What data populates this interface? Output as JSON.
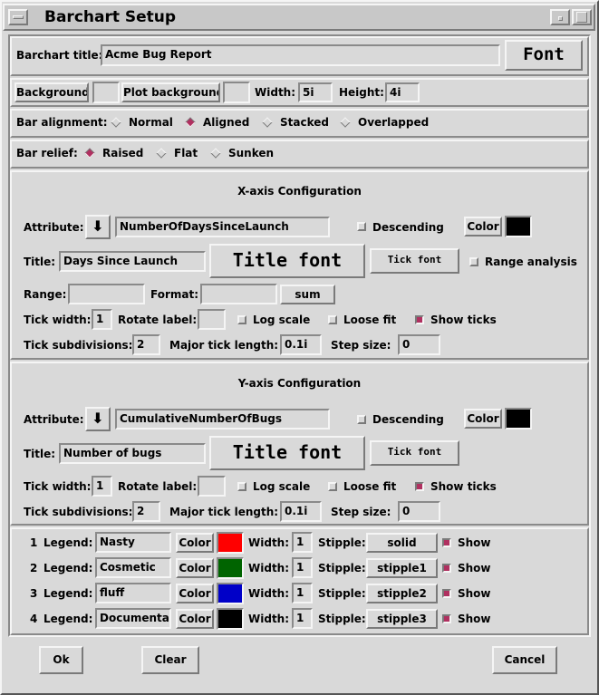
{
  "window": {
    "title": "Barchart Setup"
  },
  "general": {
    "chart_title_label": "Barchart title:",
    "chart_title_value": "Acme Bug Report",
    "font_button": "Font",
    "background_button": "Background",
    "plot_background_button": "Plot background",
    "width_label": "Width:",
    "width_value": "5i",
    "height_label": "Height:",
    "height_value": "4i"
  },
  "bar_alignment": {
    "label": "Bar alignment:",
    "options": [
      "Normal",
      "Aligned",
      "Stacked",
      "Overlapped"
    ],
    "selected": "Aligned"
  },
  "bar_relief": {
    "label": "Bar relief:",
    "options": [
      "Raised",
      "Flat",
      "Sunken"
    ],
    "selected": "Raised"
  },
  "xaxis": {
    "heading": "X-axis Configuration",
    "attribute_label": "Attribute:",
    "attribute_value": "NumberOfDaysSinceLaunch",
    "descending_label": "Descending",
    "descending_checked": false,
    "color_button": "Color",
    "color": "#000000",
    "title_label": "Title:",
    "title_value": "Days Since Launch",
    "title_font_button": "Title font",
    "tick_font_button": "Tick font",
    "range_analysis_label": "Range analysis",
    "range_analysis_checked": false,
    "range_label": "Range:",
    "range_value": "",
    "format_label": "Format:",
    "format_value": "",
    "format_button": "sum",
    "tick_width_label": "Tick width:",
    "tick_width_value": "1",
    "rotate_label": "Rotate label:",
    "rotate_value": "",
    "log_scale_label": "Log scale",
    "log_scale_checked": false,
    "loose_fit_label": "Loose fit",
    "loose_fit_checked": false,
    "show_ticks_label": "Show ticks",
    "show_ticks_checked": true,
    "tick_subdivisions_label": "Tick subdivisions:",
    "tick_subdivisions_value": "2",
    "major_tick_length_label": "Major tick length:",
    "major_tick_length_value": "0.1i",
    "step_size_label": "Step size:",
    "step_size_value": "0"
  },
  "yaxis": {
    "heading": "Y-axis Configuration",
    "attribute_label": "Attribute:",
    "attribute_value": "CumulativeNumberOfBugs",
    "descending_label": "Descending",
    "descending_checked": false,
    "color_button": "Color",
    "color": "#000000",
    "title_label": "Title:",
    "title_value": "Number of bugs",
    "title_font_button": "Title font",
    "tick_font_button": "Tick font",
    "tick_width_label": "Tick width:",
    "tick_width_value": "1",
    "rotate_label": "Rotate label:",
    "rotate_value": "",
    "log_scale_label": "Log scale",
    "log_scale_checked": false,
    "loose_fit_label": "Loose fit",
    "loose_fit_checked": false,
    "show_ticks_label": "Show ticks",
    "show_ticks_checked": true,
    "tick_subdivisions_label": "Tick subdivisions:",
    "tick_subdivisions_value": "2",
    "major_tick_length_label": "Major tick length:",
    "major_tick_length_value": "0.1i",
    "step_size_label": "Step size:",
    "step_size_value": "0"
  },
  "legend": {
    "legend_label": "Legend:",
    "color_button": "Color",
    "width_label": "Width:",
    "stipple_label": "Stipple:",
    "show_label": "Show",
    "rows": [
      {
        "num": "1",
        "name": "Nasty",
        "color": "#ff0000",
        "width": "1",
        "stipple": "solid",
        "show": true
      },
      {
        "num": "2",
        "name": "Cosmetic",
        "color": "#006400",
        "width": "1",
        "stipple": "stipple1",
        "show": true
      },
      {
        "num": "3",
        "name": "fluff",
        "color": "#0000c8",
        "width": "1",
        "stipple": "stipple2",
        "show": true
      },
      {
        "num": "4",
        "name": "Documentati",
        "color": "#000000",
        "width": "1",
        "stipple": "stipple3",
        "show": true
      }
    ]
  },
  "footer": {
    "ok": "Ok",
    "clear": "Clear",
    "cancel": "Cancel"
  }
}
